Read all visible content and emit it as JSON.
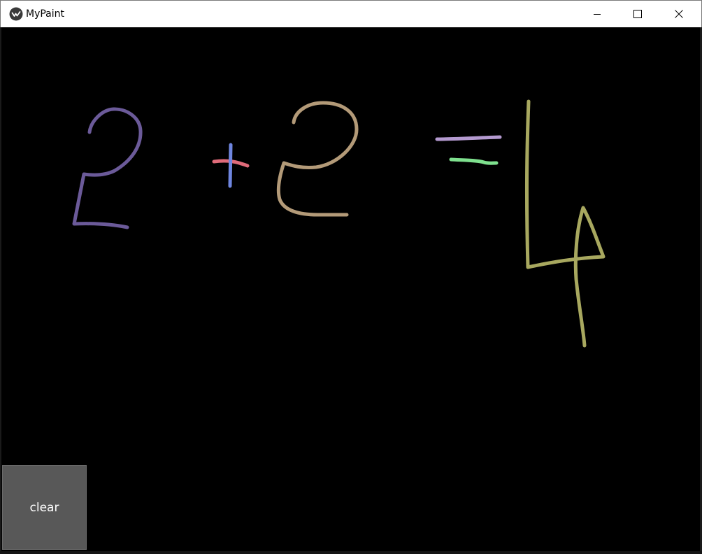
{
  "window": {
    "title": "MyPaint",
    "icon": "kivy-logo-icon",
    "controls": {
      "minimize": "minimize-icon",
      "maximize": "maximize-icon",
      "close": "close-icon"
    }
  },
  "canvas": {
    "background": "#000000",
    "strokes": [
      {
        "name": "stroke-digit-2-left",
        "color": "#6b5a99"
      },
      {
        "name": "stroke-plus-horizontal",
        "color": "#e06b7a"
      },
      {
        "name": "stroke-plus-vertical",
        "color": "#6f86e0"
      },
      {
        "name": "stroke-digit-2-right",
        "color": "#b39a78"
      },
      {
        "name": "stroke-equals-top",
        "color": "#b49ad0"
      },
      {
        "name": "stroke-equals-bottom",
        "color": "#7ee08e"
      },
      {
        "name": "stroke-digit-4",
        "color": "#a8a85f"
      }
    ]
  },
  "toolbar": {
    "clear_label": "clear",
    "clear_button_color": "#585858"
  }
}
